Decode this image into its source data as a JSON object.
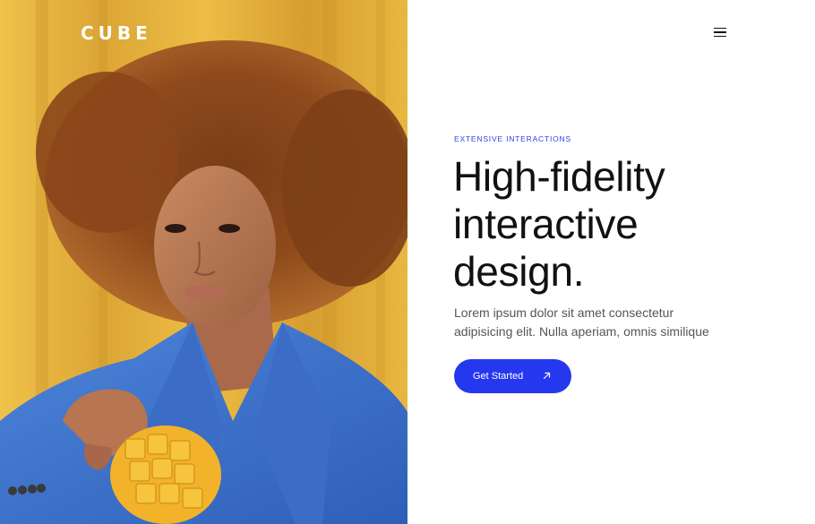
{
  "brand": {
    "logo_text": "CUBE"
  },
  "nav": {
    "menu_icon": "hamburger-menu-icon"
  },
  "hero": {
    "image_subject": "portrait-photo",
    "eyebrow": "EXTENSIVE INTERACTIONS",
    "headline_lines": [
      "High-fidelity",
      "interactive",
      "design."
    ],
    "lead_lines": [
      "Lorem ipsum dolor sit amet consectetur",
      "adipisicing elit. Nulla aperiam, omnis similique"
    ],
    "cta_label": "Get Started",
    "cta_icon": "arrow-up-right-icon"
  },
  "colors": {
    "accent": "#2538f0",
    "eyebrow": "#2c43e8",
    "heading": "#111111",
    "body_text": "#555555",
    "image_background": "#e7b43d"
  }
}
